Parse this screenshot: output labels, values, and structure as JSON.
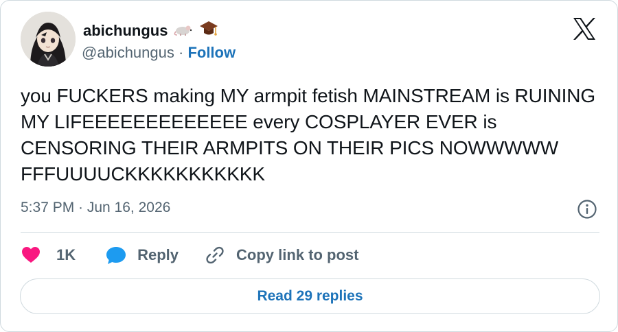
{
  "author": {
    "display_name": "abichungus",
    "handle": "@abichungus",
    "separator": " · ",
    "follow_label": "Follow",
    "badges": [
      "rat-emoji",
      "graduation-cap-emoji"
    ]
  },
  "tweet": {
    "text": "you FUCKERS making MY armpit fetish MAINSTREAM is RUINING MY LIFEEEEEEEEEEEEE every COSPLAYER EVER is CENSORING THEIR ARMPITS ON THEIR PICS NOWWWWW  FFFUUUUCKKKKKKKKKKK",
    "timestamp": "5:37 PM · Jun 16, 2026"
  },
  "actions": {
    "like_count": "1K",
    "reply_label": "Reply",
    "copy_label": "Copy link to post"
  },
  "read_replies_label": "Read 29 replies",
  "colors": {
    "like": "#f91880",
    "reply": "#1d9bf0",
    "link": "#1d73b9",
    "muted": "#536471",
    "border": "#cfd9de"
  },
  "icons": {
    "logo": "x-logo-icon",
    "info": "info-icon",
    "like": "heart-icon",
    "reply": "speech-bubble-icon",
    "copy": "link-icon"
  }
}
